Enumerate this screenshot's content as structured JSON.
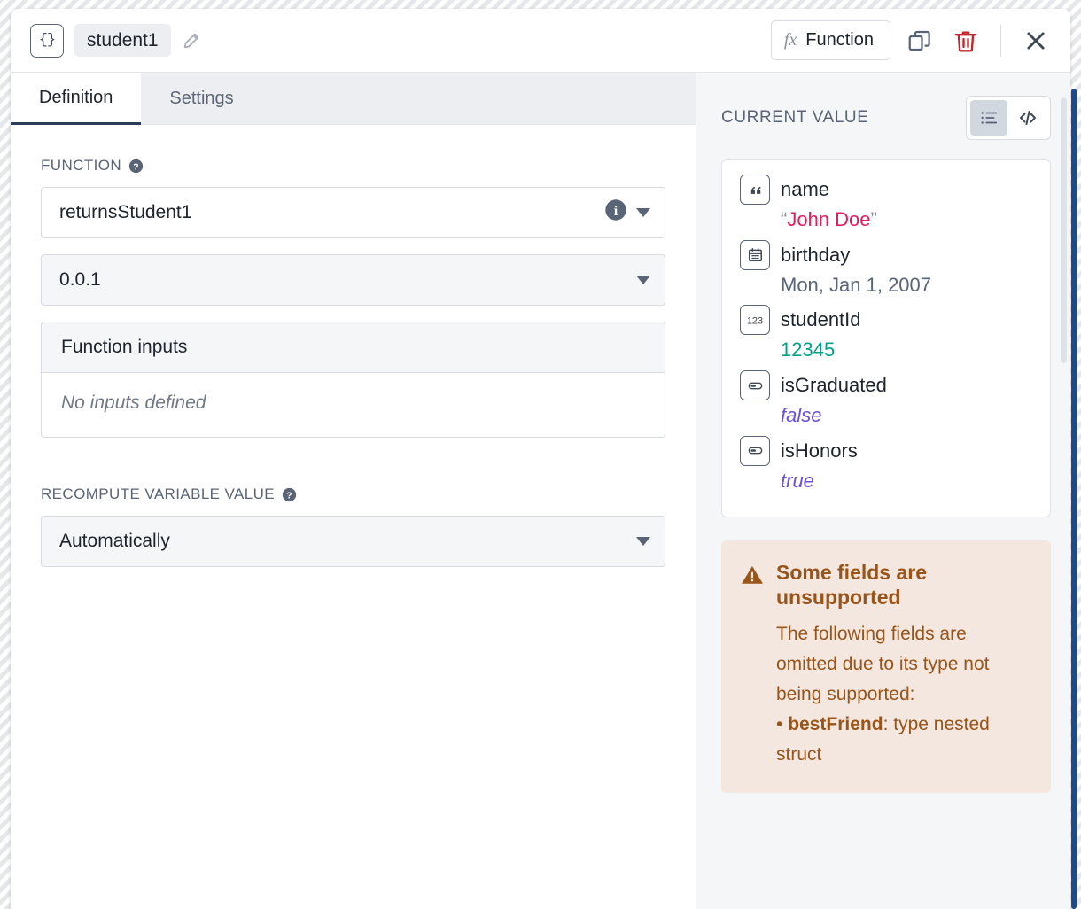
{
  "header": {
    "type_badge": "{}",
    "variable_name": "student1",
    "edit_icon": "pencil-icon",
    "function_button": {
      "glyph": "fx",
      "label": "Function"
    },
    "duplicate_icon": "duplicate-icon",
    "delete_icon": "trash-icon",
    "close_icon": "close-icon"
  },
  "tabs": [
    {
      "label": "Definition",
      "active": true
    },
    {
      "label": "Settings",
      "active": false
    }
  ],
  "definition": {
    "function_label": "FUNCTION",
    "function_help_icon": "help-icon",
    "function_select": {
      "value": "returnsStudent1",
      "info_icon": "info-icon",
      "caret_icon": "chevron-down-icon"
    },
    "version_select": {
      "value": "0.0.1",
      "caret_icon": "chevron-down-icon"
    },
    "inputs_card": {
      "header": "Function inputs",
      "empty_text": "No inputs defined"
    },
    "recompute_label": "RECOMPUTE VARIABLE VALUE",
    "recompute_help_icon": "help-icon",
    "recompute_select": {
      "value": "Automatically",
      "caret_icon": "chevron-down-icon"
    }
  },
  "current_value": {
    "title": "CURRENT VALUE",
    "view_toggle": [
      {
        "name": "list-view-icon",
        "active": true
      },
      {
        "name": "code-view-icon",
        "active": false
      }
    ],
    "fields": [
      {
        "key": "name",
        "icon": "quote-icon",
        "value": "John Doe",
        "value_kind": "string",
        "open_quote": "“",
        "close_quote": "”"
      },
      {
        "key": "birthday",
        "icon": "calendar-icon",
        "value": "Mon, Jan 1, 2007",
        "value_kind": "date"
      },
      {
        "key": "studentId",
        "icon": "number-icon",
        "icon_text": "123",
        "value": "12345",
        "value_kind": "number"
      },
      {
        "key": "isGraduated",
        "icon": "boolean-icon",
        "value": "false",
        "value_kind": "boolean"
      },
      {
        "key": "isHonors",
        "icon": "boolean-icon",
        "value": "true",
        "value_kind": "boolean"
      }
    ]
  },
  "warning": {
    "icon": "warning-triangle-icon",
    "title": "Some fields are unsupported",
    "body_intro": "The following fields are omitted due to its type not being supported:",
    "bullet_marker": "•",
    "bullet_field": "bestFriend",
    "bullet_rest": ": type nested struct"
  },
  "colors": {
    "string": "#e31c5f",
    "number": "#00a189",
    "boolean": "#6c4fd6",
    "date": "#5a6477",
    "warning_text": "#99541a",
    "warning_bg": "#f3e7df",
    "delete": "#c0272d",
    "accent": "#2d3c55"
  }
}
